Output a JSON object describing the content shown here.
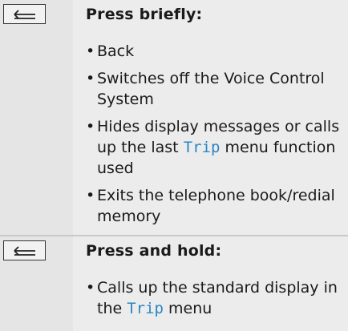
{
  "row1": {
    "key_icon": "back-key-icon",
    "heading": "Press briefly:",
    "items": [
      {
        "text": "Back"
      },
      {
        "text": "Switches off the Voice Control System"
      },
      {
        "pre": "Hides display messages or calls up the last ",
        "term": "Trip",
        "post": " menu function used"
      },
      {
        "text": "Exits the telephone book/redial memory"
      }
    ]
  },
  "row2": {
    "key_icon": "back-key-icon",
    "heading": "Press and hold:",
    "items": [
      {
        "pre": "Calls up the standard display in the ",
        "term": "Trip",
        "post": " menu"
      }
    ]
  },
  "colors": {
    "icon_column_bg": "#e5e5e5",
    "text_column_bg": "#ececec",
    "term_color": "#2a86c4",
    "divider": "#c9c9c9"
  }
}
